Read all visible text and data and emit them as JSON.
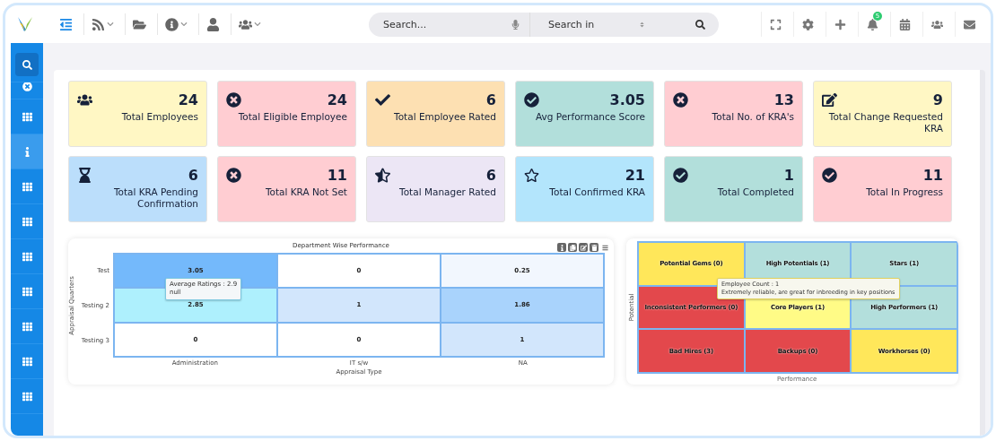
{
  "topbar": {
    "left_icons": [
      {
        "kind": "indent",
        "caret": false,
        "selected": true
      },
      {
        "kind": "rss",
        "caret": true,
        "selected": false
      },
      {
        "kind": "folder",
        "caret": false,
        "selected": false
      },
      {
        "kind": "info",
        "caret": true,
        "selected": false
      },
      {
        "kind": "user",
        "caret": false,
        "selected": false
      },
      {
        "kind": "users",
        "caret": true,
        "selected": false
      }
    ],
    "search": {
      "placeholder": "Search...",
      "scope": "Search in"
    },
    "right_icons": [
      {
        "kind": "scan"
      },
      {
        "kind": "gear"
      },
      {
        "kind": "plus"
      },
      {
        "kind": "bell",
        "badge": "5"
      },
      {
        "kind": "calendar"
      },
      {
        "kind": "users"
      },
      {
        "kind": "mail"
      }
    ]
  },
  "sidebar": {
    "items": [
      {
        "kind": "search",
        "selected": true
      },
      {
        "kind": "half",
        "selected": false
      },
      {
        "kind": "grid",
        "selected": false
      },
      {
        "kind": "info",
        "selected": false,
        "highlighted": true
      },
      {
        "kind": "grid",
        "selected": false
      },
      {
        "kind": "grid",
        "selected": false
      },
      {
        "kind": "grid",
        "selected": false
      },
      {
        "kind": "grid",
        "selected": false
      },
      {
        "kind": "grid",
        "selected": false
      },
      {
        "kind": "grid",
        "selected": false
      },
      {
        "kind": "grid",
        "selected": false
      }
    ]
  },
  "cards": [
    {
      "kind": "users",
      "value": "24",
      "label": "Total Employees",
      "color": "#fff7c4"
    },
    {
      "kind": "xcircle",
      "value": "24",
      "label": "Total Eligible Employee",
      "color": "#ffcdd2"
    },
    {
      "kind": "check",
      "value": "6",
      "label": "Total Employee Rated",
      "color": "#fde0b2"
    },
    {
      "kind": "checkcircle",
      "value": "3.05",
      "label": "Avg Performance Score",
      "color": "#b2dfdb"
    },
    {
      "kind": "xcircle",
      "value": "13",
      "label": "Total No. of KRA's",
      "color": "#ffcdd2"
    },
    {
      "kind": "edit",
      "value": "9",
      "label": "Total Change Requested KRA",
      "color": "#fff7c4"
    },
    {
      "kind": "hourglass",
      "value": "6",
      "label": "Total KRA Pending Confirmation",
      "color": "#bbdefb"
    },
    {
      "kind": "xcircle",
      "value": "11",
      "label": "Total KRA Not Set",
      "color": "#ffcdd2"
    },
    {
      "kind": "starhalf",
      "value": "6",
      "label": "Total Manager Rated",
      "color": "#ece6f5"
    },
    {
      "kind": "star",
      "value": "21",
      "label": "Total Confirmed KRA",
      "color": "#b3e5fc"
    },
    {
      "kind": "checkcircle",
      "value": "1",
      "label": "Total Completed",
      "color": "#b2dfdb"
    },
    {
      "kind": "checkcircle",
      "value": "11",
      "label": "Total In Progress",
      "color": "#ffcdd2"
    }
  ],
  "heatmap": {
    "title": "Department Wise Performance",
    "ylabel": "Appraisal Quarters",
    "xlabel": "Appraisal Type",
    "rows": [
      {
        "label": "Test",
        "cells": [
          {
            "value": "3.05",
            "color": "#74b9fb"
          },
          {
            "value": "0",
            "color": "#ffffff"
          },
          {
            "value": "0.25",
            "color": "#f2f7fe"
          }
        ]
      },
      {
        "label": "Testing 2",
        "cells": [
          {
            "value": "2.85",
            "color": "#aef0fd"
          },
          {
            "value": "1",
            "color": "#d2e6fc"
          },
          {
            "value": "1.86",
            "color": "#a9d3fc"
          }
        ]
      },
      {
        "label": "Testing 3",
        "cells": [
          {
            "value": "0",
            "color": "#ffffff"
          },
          {
            "value": "0",
            "color": "#ffffff"
          },
          {
            "value": "1",
            "color": "#d2e6fc"
          }
        ]
      }
    ],
    "x_categories": [
      "Administration",
      "IT s/w",
      "NA"
    ],
    "tooltip": [
      "Average Ratings : 2.9",
      "null"
    ]
  },
  "ninebox": {
    "ylabel": "Potential",
    "xlabel": "Performance",
    "cells": [
      {
        "label": "Potential Gems (0)",
        "color": "#ffe75a"
      },
      {
        "label": "High Potentials (1)",
        "color": "#b3dfdc"
      },
      {
        "label": "Stars (1)",
        "color": "#b3dfdc"
      },
      {
        "label": "Inconsistent Performers (0)",
        "color": "#e3484c"
      },
      {
        "label": "Core Players (1)",
        "color": "#fffb86"
      },
      {
        "label": "High Performers (1)",
        "color": "#b3dfdc"
      },
      {
        "label": "Bad Hires (3)",
        "color": "#e3484c"
      },
      {
        "label": "Backups (0)",
        "color": "#e3484c"
      },
      {
        "label": "Workhorses (0)",
        "color": "#ffe75a"
      }
    ],
    "tooltip": [
      "Employee Count : 1",
      "Extremely reliable, are great for inbreeding in key positions"
    ]
  }
}
